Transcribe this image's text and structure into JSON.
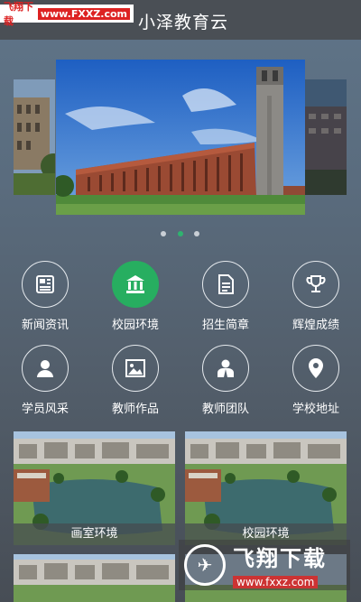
{
  "watermark_top": {
    "part1": "飞翔下载",
    "part2": "www.FXXZ.com"
  },
  "app_title": "小泽教育云",
  "carousel": {
    "dots": 3,
    "active_dot": 2
  },
  "menu": [
    {
      "label": "新闻资讯",
      "icon": "newspaper-icon",
      "active": false
    },
    {
      "label": "校园环境",
      "icon": "bank-building-icon",
      "active": true
    },
    {
      "label": "招生简章",
      "icon": "document-icon",
      "active": false
    },
    {
      "label": "辉煌成绩",
      "icon": "trophy-icon",
      "active": false
    },
    {
      "label": "学员风采",
      "icon": "person-icon",
      "active": false
    },
    {
      "label": "教师作品",
      "icon": "picture-icon",
      "active": false
    },
    {
      "label": "教师团队",
      "icon": "teacher-icon",
      "active": false
    },
    {
      "label": "学校地址",
      "icon": "location-pin-icon",
      "active": false
    }
  ],
  "cards": [
    {
      "label": "画室环境"
    },
    {
      "label": "校园环境"
    }
  ],
  "watermark_bottom": {
    "brand": "飞翔下载",
    "url": "www.fxxz.com"
  },
  "colors": {
    "accent": "#27ae60",
    "topbar": "#4a4f55"
  }
}
